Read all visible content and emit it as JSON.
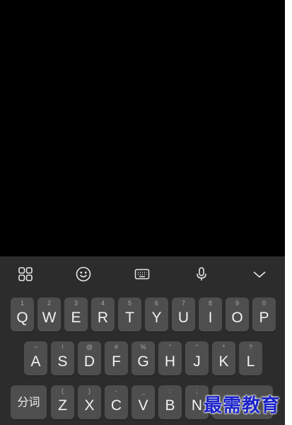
{
  "toolbar": {
    "items": [
      {
        "icon": "grid-apps-icon"
      },
      {
        "icon": "emoji-icon"
      },
      {
        "icon": "keyboard-icon"
      },
      {
        "icon": "microphone-icon"
      },
      {
        "icon": "chevron-down-icon"
      }
    ]
  },
  "keyboard": {
    "row1": [
      {
        "main": "Q",
        "sub": "1"
      },
      {
        "main": "W",
        "sub": "2"
      },
      {
        "main": "E",
        "sub": "3"
      },
      {
        "main": "R",
        "sub": "4"
      },
      {
        "main": "T",
        "sub": "5"
      },
      {
        "main": "Y",
        "sub": "6"
      },
      {
        "main": "U",
        "sub": "7"
      },
      {
        "main": "I",
        "sub": "8"
      },
      {
        "main": "O",
        "sub": "9"
      },
      {
        "main": "P",
        "sub": "0"
      }
    ],
    "row2": [
      {
        "main": "A",
        "sub": "~"
      },
      {
        "main": "S",
        "sub": "!"
      },
      {
        "main": "D",
        "sub": "@"
      },
      {
        "main": "F",
        "sub": "#"
      },
      {
        "main": "G",
        "sub": "%"
      },
      {
        "main": "H",
        "sub": "\""
      },
      {
        "main": "J",
        "sub": "\""
      },
      {
        "main": "K",
        "sub": "*"
      },
      {
        "main": "L",
        "sub": "?"
      }
    ],
    "row3": [
      {
        "main": "Z",
        "sub": "("
      },
      {
        "main": "X",
        "sub": ")"
      },
      {
        "main": "C",
        "sub": "-"
      },
      {
        "main": "V",
        "sub": "_"
      },
      {
        "main": "B",
        "sub": ":"
      },
      {
        "main": "N",
        "sub": ";"
      }
    ],
    "segment_key": "分词"
  },
  "watermark": "最需教育",
  "colors": {
    "background": "#000000",
    "keyboard_bg": "#2c2c2c",
    "key_bg": "#4e4e4e",
    "key_text": "#f2f2f2",
    "watermark": "#1a22c8"
  }
}
